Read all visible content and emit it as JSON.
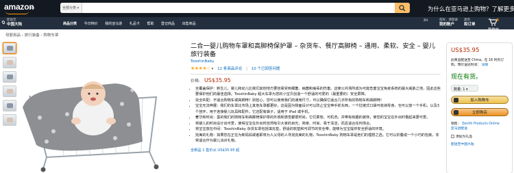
{
  "header": {
    "logo": "amazon",
    "logo_sub": ".cn",
    "search_category": "全部分类",
    "search_placeholder": "",
    "promo": "为什么在亚马逊上购物？了解更多"
  },
  "nav": {
    "deliver_line1": "配送至",
    "deliver_line2": "中国大陆",
    "links": [
      "商品分类",
      "今日特价",
      "我的亚马逊",
      "礼品卡",
      "帮助",
      "登记商品",
      "出售商品"
    ],
    "lang": "ZH",
    "account_line1": "您好，请登录",
    "account_line2": "我的账户",
    "orders_line1": "退货",
    "orders_line2": "和订单",
    "cart_count": "0",
    "cart_label": "购物车"
  },
  "breadcrumb": "母婴用品 › 旅行装备 › 购物车罩",
  "product": {
    "title": "二合一婴儿购物车罩和高脚椅保护罩 – 杂货车、餐厅高脚椅 – 通用、柔软、安全 – 婴儿旅行装备",
    "brand": "TooshinBaby",
    "stars": "★★★★☆",
    "ratings": "12 条商品评论",
    "answers": "10 个已回答问题",
    "price_label": "价格:",
    "price": "US$35.95",
    "bullets": [
      "全覆盖保护：新生儿、婴儿和幼儿比我们其他地方要容易受到细菌、病菌和病毒的伤害。这使公共场所成为可能危害宝宝免疫系统的最大威胁之地，因此这些要保护他们的最佳选择。TooshinBaby 超大车罩为您的小宝贝创造一个舒适的可爱的（最重要的）安全屏障。",
      "完全匹配：不适合购物车或高脚椅？别担心，您可以使用我们的通用尺寸，可以确保它适合几乎所有的购物车和高脚椅！",
      "宝宝无法伸展：我们的车罩比市场上其他车罩都更好，这是因为侧面设计可以防止宝宝伸手抓东西，一个拉链式口袋可收纳零食，也可以放一个手机，以及3个挂环，用于连接婴儿玩具和配件。它还配有袋子，适用于 iPad 或手机。",
      "奢华和时尚：墨的我们的购物车和高脚椅保护罩的外观和感觉都很时尚，它们柔软、可机洗，并带有有趣的装饰，使您的宝宝在外出时看起来更可爱。",
      "将婴儿的时尚设计出可爱，使得宝宝在外出时自然吸引大家的目光，简单、时尚、易于清洁，而且适合任何场合。",
      "将宝宝放在中间：TooshinBaby 杂货车罩包括填充垫，舒适的软垫和可调节的安全带，能够为宝宝提供安全舒适的环境。",
      "完美的礼物：如果您在正在为新妈妈或者即将为人父母的人寻找完美的礼物，TooshinBaby 购物车罩是他们的理想之选。它可以折叠成一个小巧的包装，非常适合作为婴儿派对礼物。"
    ],
    "new_offers_prefix": "全新品",
    "new_offers_count": "1",
    "new_offers_mid": "售价从 US$35.95 起",
    "new_offers_suffix": "起"
  },
  "buybox": {
    "price": "US$35.95",
    "shipping": "此商品配送至 China。在 16 时内订购，预计送达时间：",
    "details_link": "详情",
    "stock": "现在有货。",
    "qty_label": "数量: 1",
    "add_to_cart": "加入购物车",
    "buy_now": "立即购买",
    "seller_prefix": "销售：",
    "seller_name": "Zenith Products Online",
    "fulfilled": "亚马逊配送",
    "gift": "添加为礼品",
    "wishlist": "配送至中国大陆"
  },
  "colors": {
    "nav_dark": "#131921",
    "nav_secondary": "#232f3e",
    "price_red": "#b12704",
    "link_blue": "#0066c0",
    "stock_green": "#007600",
    "star_orange": "#ffa41c",
    "button_yellow": "#f0c14b",
    "button_orange": "#ed9220"
  }
}
